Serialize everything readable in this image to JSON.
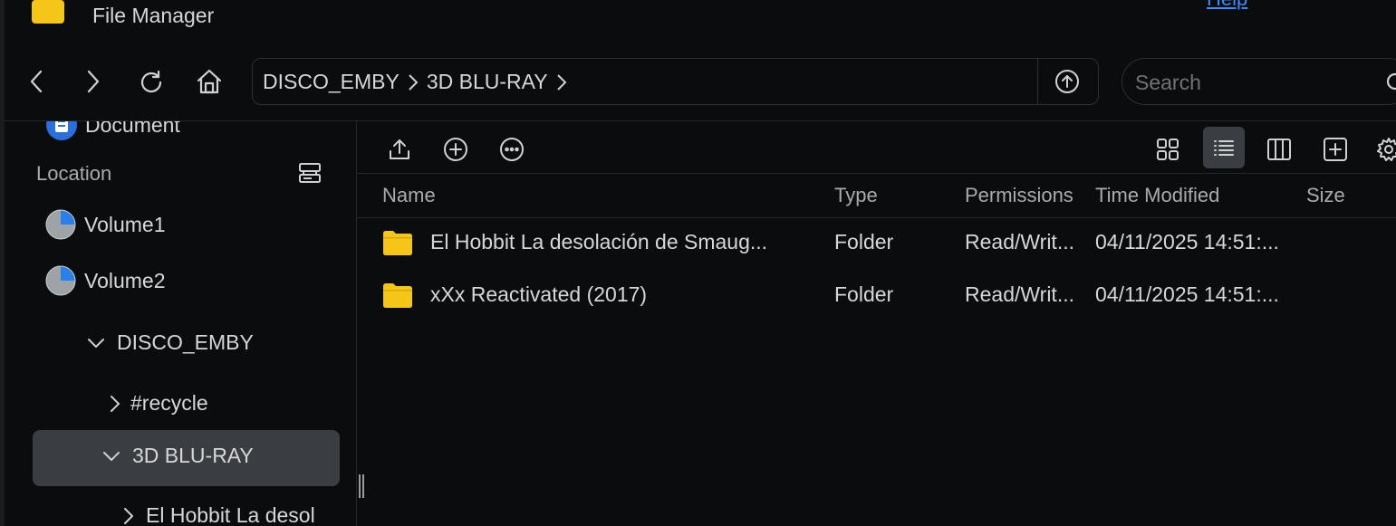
{
  "app": {
    "title": "File Manager",
    "help_label": "Help"
  },
  "toolbar": {
    "breadcrumb": [
      "DISCO_EMBY",
      "3D BLU-RAY"
    ],
    "search_placeholder": "Search"
  },
  "sidebar": {
    "partial_item": "Document",
    "location_label": "Location",
    "volumes": [
      "Volume1",
      "Volume2"
    ],
    "tree": {
      "disco_emby": "DISCO_EMBY",
      "recycle": "#recycle",
      "bluray": "3D BLU-RAY",
      "hobbit": "El Hobbit La desol"
    }
  },
  "table": {
    "columns": [
      "Name",
      "Type",
      "Permissions",
      "Time Modified",
      "Size"
    ],
    "rows": [
      {
        "name": "El Hobbit La desolación de Smaug...",
        "type": "Folder",
        "permissions": "Read/Writ...",
        "modified": "04/11/2025 14:51:...",
        "size": ""
      },
      {
        "name": "xXx Reactivated (2017)",
        "type": "Folder",
        "permissions": "Read/Writ...",
        "modified": "04/11/2025 14:51:...",
        "size": ""
      }
    ]
  },
  "colors": {
    "background": "#0b0c0e",
    "selected": "#3a3d41",
    "folder": "#f5c518",
    "accent": "#3b8cff"
  }
}
